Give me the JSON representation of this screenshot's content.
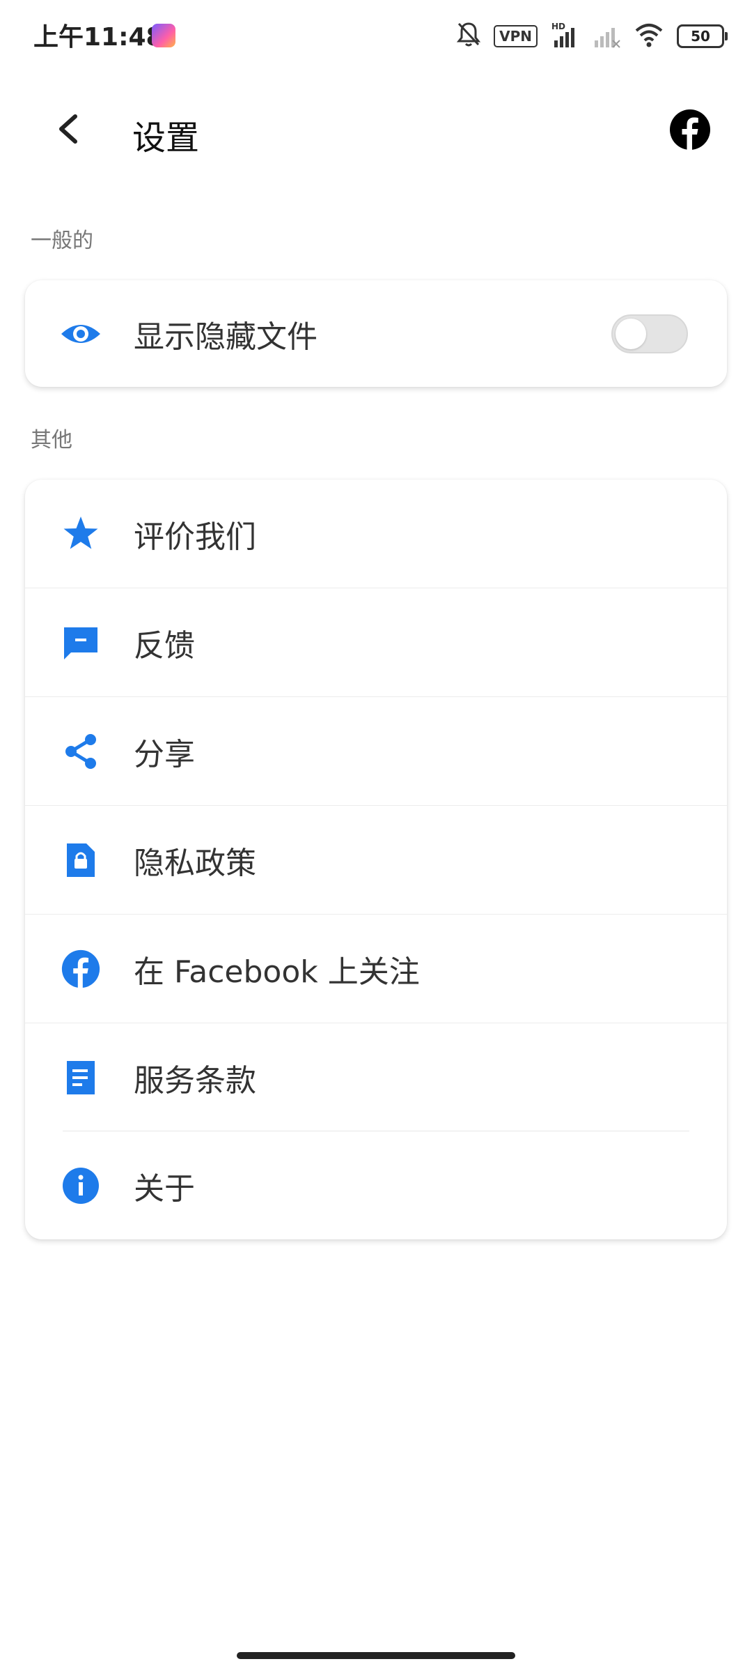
{
  "status_bar": {
    "time": "上午11:48",
    "vpn": "VPN",
    "battery": "50"
  },
  "header": {
    "title": "设置"
  },
  "sections": {
    "general": {
      "label": "一般的",
      "items": [
        {
          "label": "显示隐藏文件",
          "icon": "eye-icon",
          "toggle_on": false
        }
      ]
    },
    "other": {
      "label": "其他",
      "items": [
        {
          "label": "评价我们",
          "icon": "star-icon"
        },
        {
          "label": "反馈",
          "icon": "feedback-icon"
        },
        {
          "label": "分享",
          "icon": "share-icon"
        },
        {
          "label": "隐私政策",
          "icon": "privacy-lock-icon"
        },
        {
          "label": "在 Facebook 上关注",
          "icon": "facebook-icon"
        },
        {
          "label": "服务条款",
          "icon": "document-icon"
        },
        {
          "label": "关于",
          "icon": "info-icon"
        }
      ]
    }
  },
  "colors": {
    "accent": "#1E7BEA",
    "text": "#333333",
    "section_label": "#777777"
  }
}
